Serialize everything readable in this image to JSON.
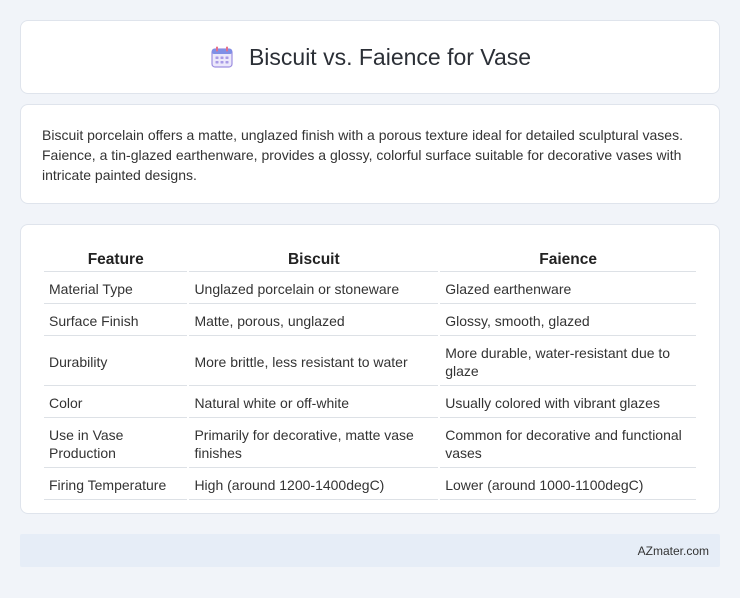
{
  "header": {
    "title": "Biscuit vs. Faience for Vase",
    "icon": "calendar-icon"
  },
  "description": {
    "text": "Biscuit porcelain offers a matte, unglazed finish with a porous texture ideal for detailed sculptural vases. Faience, a tin-glazed earthenware, provides a glossy, colorful surface suitable for decorative vases with intricate painted designs."
  },
  "table": {
    "headers": [
      "Feature",
      "Biscuit",
      "Faience"
    ],
    "rows": [
      [
        "Material Type",
        "Unglazed porcelain or stoneware",
        "Glazed earthenware"
      ],
      [
        "Surface Finish",
        "Matte, porous, unglazed",
        "Glossy, smooth, glazed"
      ],
      [
        "Durability",
        "More brittle, less resistant to water",
        "More durable, water-resistant due to glaze"
      ],
      [
        "Color",
        "Natural white or off-white",
        "Usually colored with vibrant glazes"
      ],
      [
        "Use in Vase Production",
        "Primarily for decorative, matte vase finishes",
        "Common for decorative and functional vases"
      ],
      [
        "Firing Temperature",
        "High (around 1200-1400degC)",
        "Lower (around 1000-1100degC)"
      ]
    ]
  },
  "footer": {
    "brand": "AZmater.com"
  },
  "colors": {
    "page_bg": "#f1f4f9",
    "card_bg": "#ffffff",
    "footer_bg": "#e6edf7",
    "icon_accent": "#8f7fd6"
  }
}
